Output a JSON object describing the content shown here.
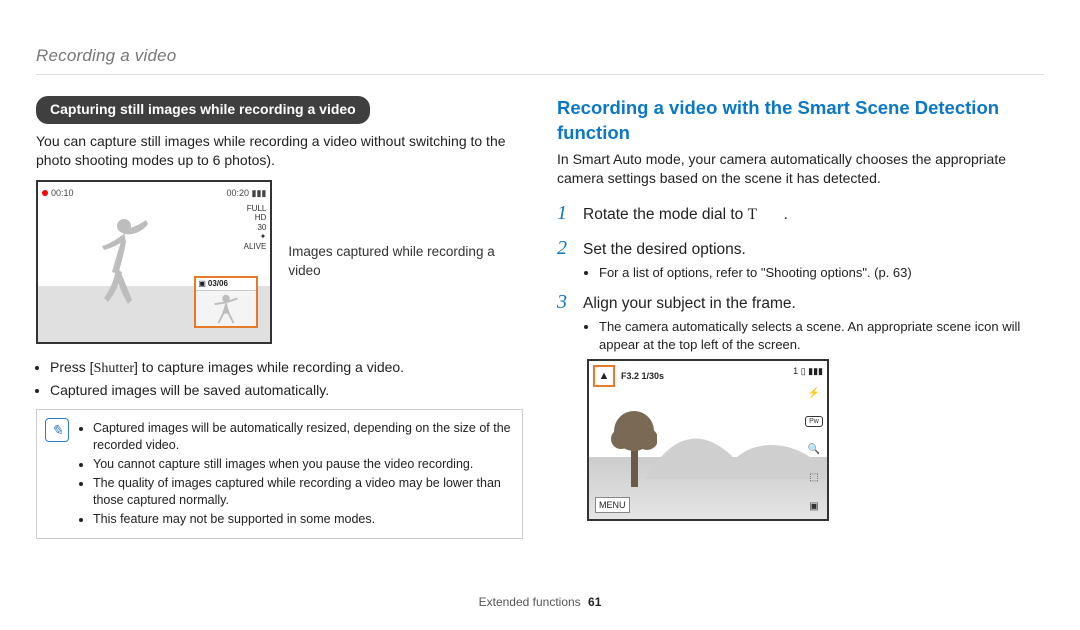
{
  "breadcrumb": "Recording a video",
  "left": {
    "pill": "Capturing still images while recording a video",
    "intro": "You can capture still images while recording a video without switching to the photo shooting modes up to 6 photos).",
    "screenshot": {
      "rec_time": "00:10",
      "remain_time": "00:20",
      "side1": "FULL",
      "side2": "HD",
      "side3": "30",
      "side4": "ALIVE",
      "thumb_count": "03/06"
    },
    "caption": "Images captured while recording a video",
    "bullets": [
      "Press [Shutter] to capture images while recording a video.",
      "Captured images will be saved automatically."
    ],
    "notes": [
      "Captured images will be automatically resized, depending on the size of the recorded video.",
      "You cannot capture still images when you pause the video recording.",
      "The quality of images captured while recording a video may be lower than those captured normally.",
      "This feature may not be supported in some modes."
    ]
  },
  "right": {
    "heading": "Recording a video with the Smart Scene Detection function",
    "intro": "In Smart Auto mode, your camera automatically chooses the appropriate camera settings based on the scene it has detected.",
    "steps": {
      "s1": "Rotate the mode dial to ",
      "s1_tail": ".",
      "s2": "Set the desired options.",
      "s2_sub": "For a list of options, refer to \"Shooting options\". (p. 63)",
      "s3": "Align your subject in the frame.",
      "s3_sub": "The camera automatically selects a scene. An appropriate scene icon will appear at the top left of the screen."
    },
    "screenshot": {
      "exposure": "F3.2  1/30s",
      "count": "1",
      "menu": "MENU"
    }
  },
  "footer": {
    "section": "Extended functions",
    "page": "61"
  }
}
